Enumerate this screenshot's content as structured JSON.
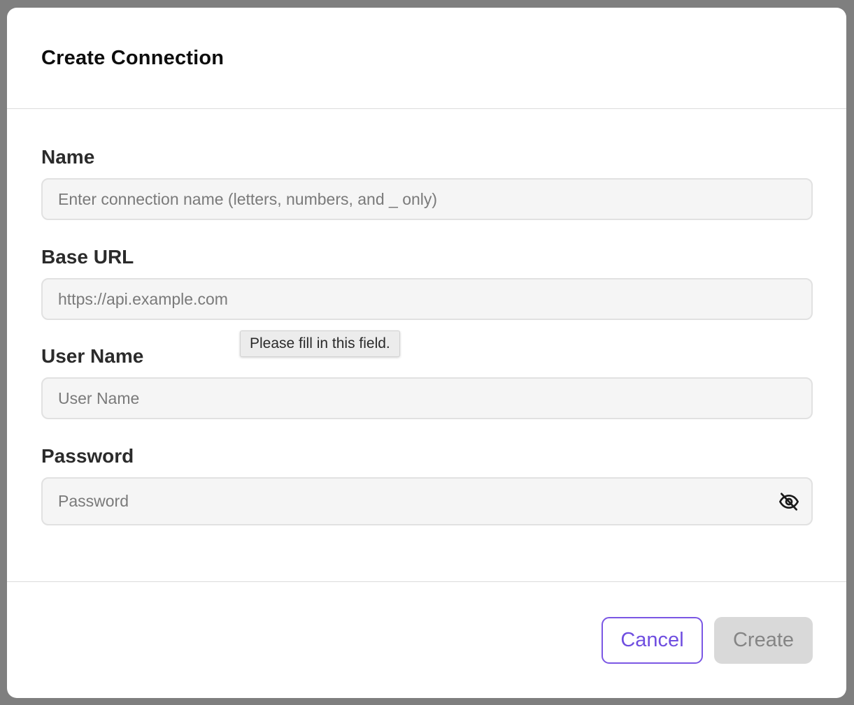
{
  "dialog": {
    "title": "Create Connection"
  },
  "fields": {
    "name": {
      "label": "Name",
      "value": "",
      "placeholder": "Enter connection name (letters, numbers, and _ only)"
    },
    "base_url": {
      "label": "Base URL",
      "value": "",
      "placeholder": "https://api.example.com"
    },
    "user_name": {
      "label": "User Name",
      "value": "",
      "placeholder": "User Name"
    },
    "password": {
      "label": "Password",
      "value": "",
      "placeholder": "Password",
      "toggle_icon": "eye-off-icon"
    }
  },
  "validation_tooltip": {
    "text": "Please fill in this field."
  },
  "footer": {
    "cancel_label": "Cancel",
    "create_label": "Create"
  },
  "colors": {
    "accent": "#6f4ee0",
    "disabled_bg": "#d9d9d9",
    "disabled_text": "#858585"
  }
}
